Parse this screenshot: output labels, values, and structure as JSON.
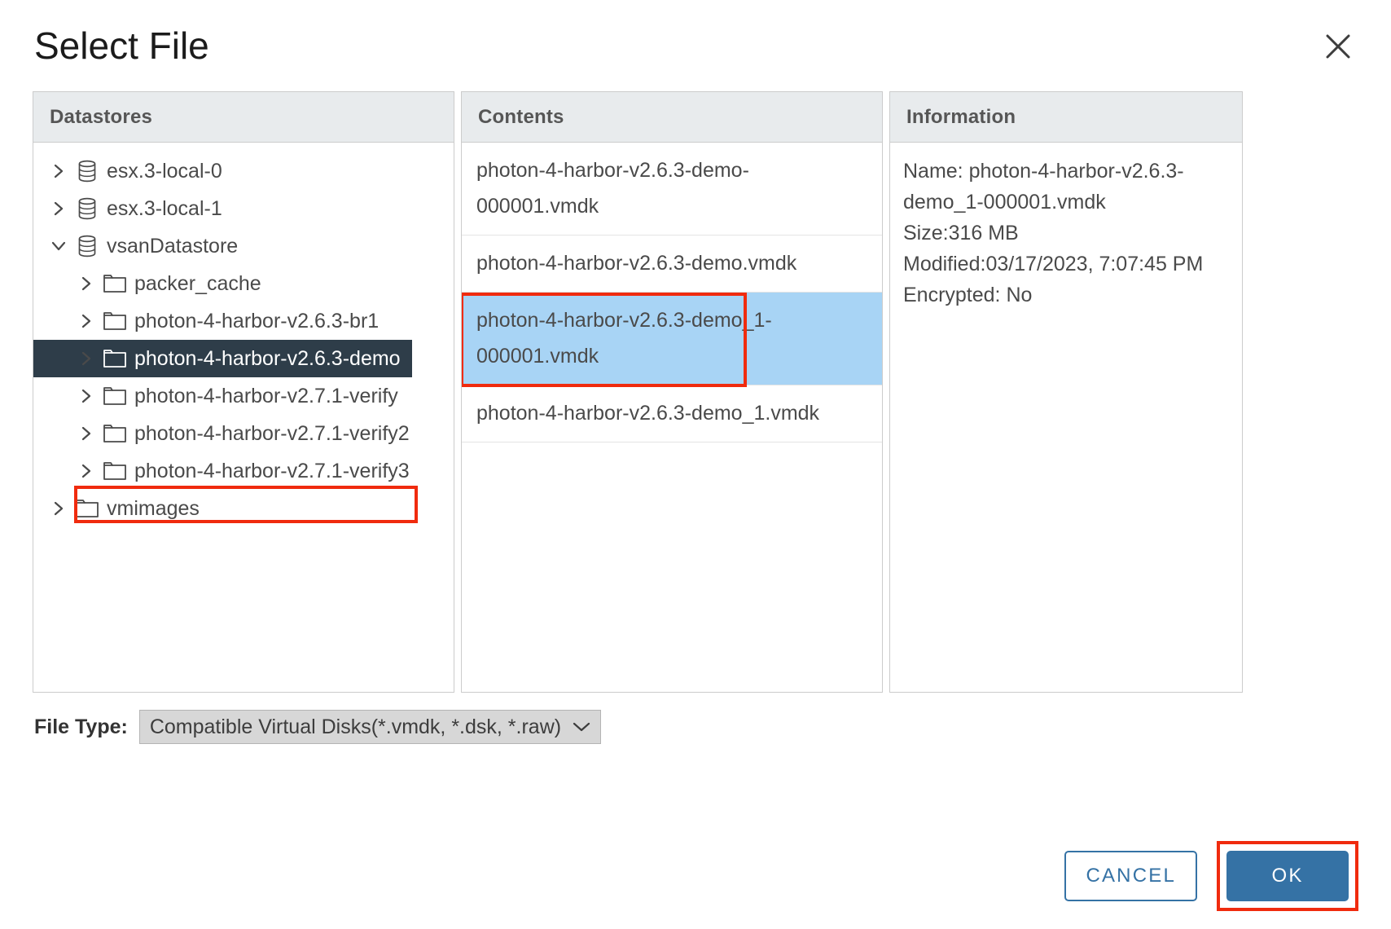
{
  "dialog": {
    "title": "Select File",
    "close_icon": "close-icon"
  },
  "panels": {
    "datastores": {
      "header": "Datastores",
      "tree": [
        {
          "label": "esx.3-local-0",
          "icon": "datastore-icon",
          "depth": 0,
          "expanded": false,
          "selected": false
        },
        {
          "label": "esx.3-local-1",
          "icon": "datastore-icon",
          "depth": 0,
          "expanded": false,
          "selected": false
        },
        {
          "label": "vsanDatastore",
          "icon": "datastore-icon",
          "depth": 0,
          "expanded": true,
          "selected": false
        },
        {
          "label": "packer_cache",
          "icon": "folder-icon",
          "depth": 1,
          "expanded": false,
          "selected": false
        },
        {
          "label": "photon-4-harbor-v2.6.3-br1",
          "icon": "folder-icon",
          "depth": 1,
          "expanded": false,
          "selected": false
        },
        {
          "label": "photon-4-harbor-v2.6.3-demo",
          "icon": "folder-icon",
          "depth": 1,
          "expanded": false,
          "selected": true
        },
        {
          "label": "photon-4-harbor-v2.7.1-verify",
          "icon": "folder-icon",
          "depth": 1,
          "expanded": false,
          "selected": false
        },
        {
          "label": "photon-4-harbor-v2.7.1-verify2",
          "icon": "folder-icon",
          "depth": 1,
          "expanded": false,
          "selected": false
        },
        {
          "label": "photon-4-harbor-v2.7.1-verify3",
          "icon": "folder-icon",
          "depth": 1,
          "expanded": false,
          "selected": false
        },
        {
          "label": "vmimages",
          "icon": "folder-icon",
          "depth": 0,
          "expanded": false,
          "selected": false
        }
      ]
    },
    "contents": {
      "header": "Contents",
      "files": [
        {
          "name": "photon-4-harbor-v2.6.3-demo-000001.vmdk",
          "selected": false
        },
        {
          "name": "photon-4-harbor-v2.6.3-demo.vmdk",
          "selected": false
        },
        {
          "name": "photon-4-harbor-v2.6.3-demo_1-000001.vmdk",
          "selected": true
        },
        {
          "name": "photon-4-harbor-v2.6.3-demo_1.vmdk",
          "selected": false
        }
      ]
    },
    "information": {
      "header": "Information",
      "lines": [
        "Name: photon-4-harbor-v2.6.3-demo_1-000001.vmdk",
        "Size:316 MB",
        "Modified:03/17/2023, 7:07:45 PM",
        "Encrypted: No"
      ]
    }
  },
  "file_type": {
    "label": "File Type:",
    "selected": "Compatible Virtual Disks(*.vmdk, *.dsk, *.raw)",
    "chevron_icon": "chevron-down-icon"
  },
  "footer": {
    "cancel_label": "CANCEL",
    "ok_label": "OK"
  },
  "colors": {
    "accent_blue": "#3572a5",
    "selection_blue": "#a8d4f5",
    "tree_selection": "#2e3d49",
    "annotation_red": "#f02b0e",
    "panel_header_bg": "#e8ebed"
  }
}
